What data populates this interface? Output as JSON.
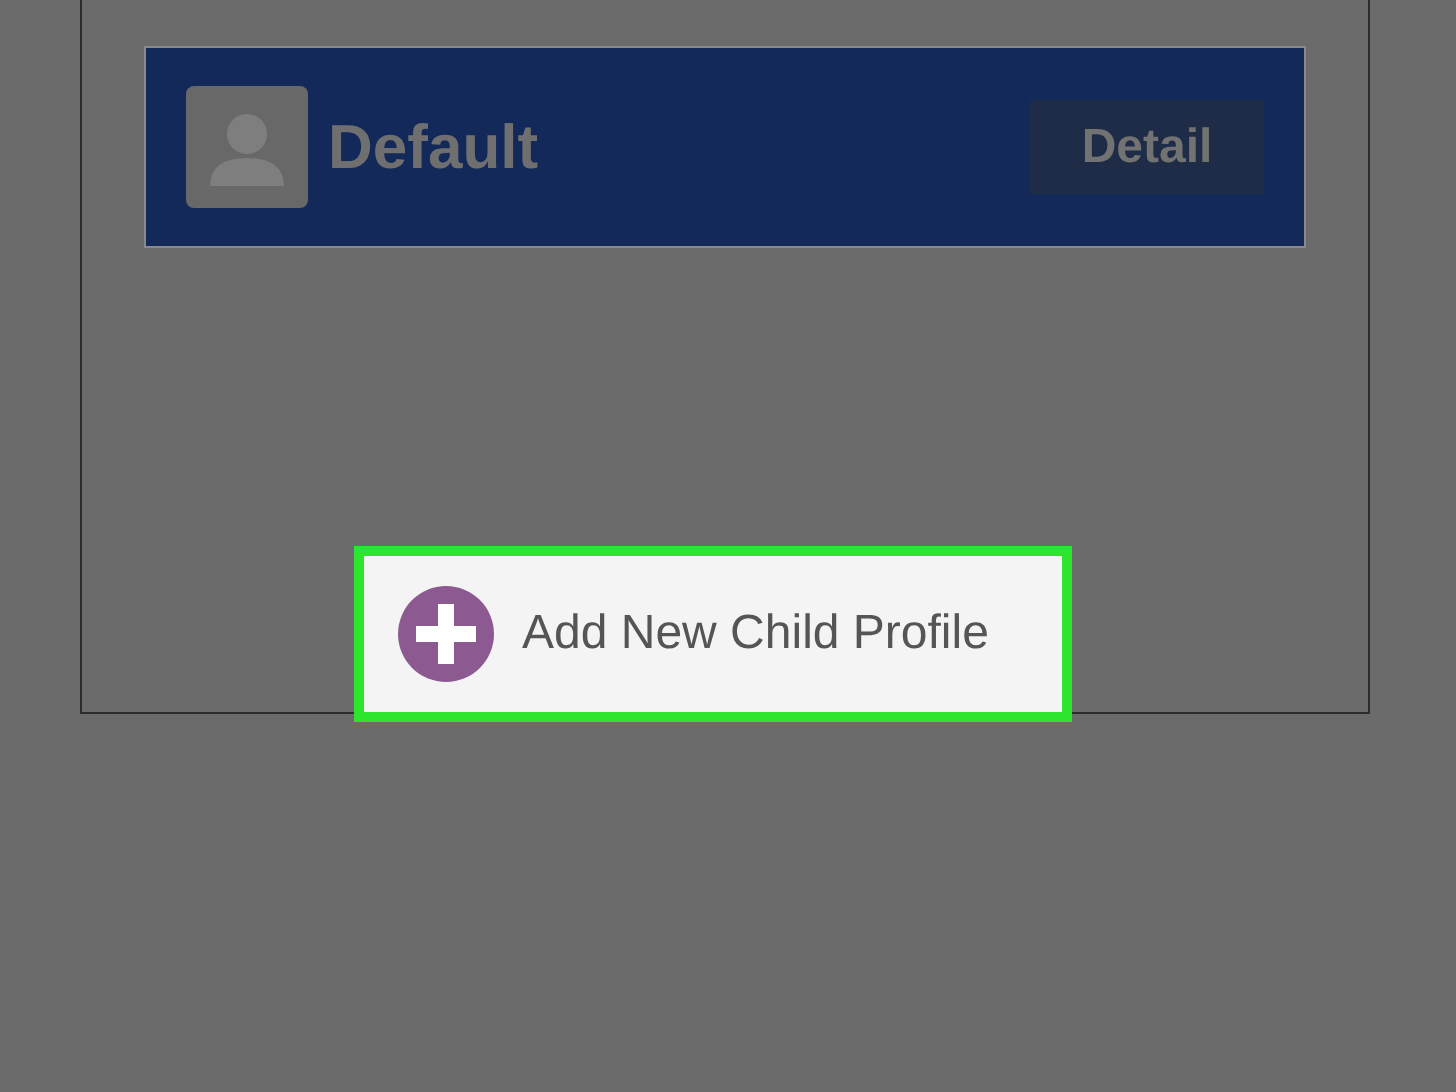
{
  "profiles": [
    {
      "name": "Default",
      "action": "Detail"
    }
  ],
  "add_button": {
    "label": "Add New Child Profile",
    "highlighted": true
  }
}
